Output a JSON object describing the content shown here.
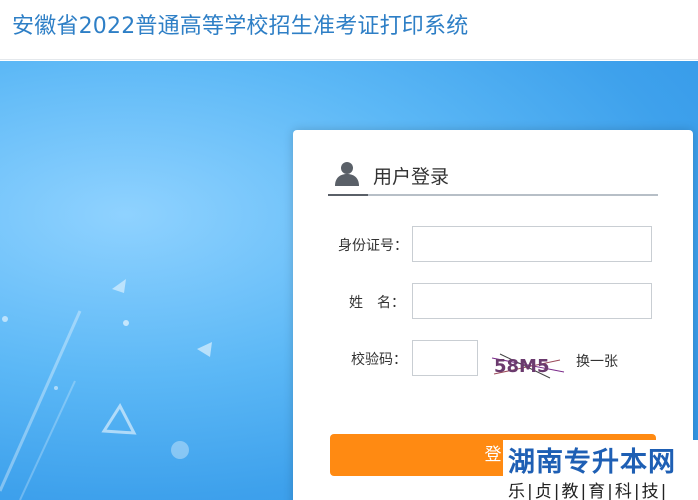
{
  "header": {
    "title": "安徽省2022普通高等学校招生准考证打印系统"
  },
  "login": {
    "heading": "用户登录",
    "id_label": "身份证号：",
    "id_value": "",
    "name_label": "姓　名：",
    "name_value": "",
    "captcha_label": "校验码：",
    "captcha_value": "",
    "captcha_text": "58M5",
    "refresh_label": "换一张",
    "submit_label": "登"
  },
  "watermark": {
    "brand": "湖南专升本网",
    "tagline": "乐|贞|教|育|科|技|"
  },
  "colors": {
    "title": "#2e7fc6",
    "button": "#ff8a12",
    "hero": "#3ea1ec"
  }
}
